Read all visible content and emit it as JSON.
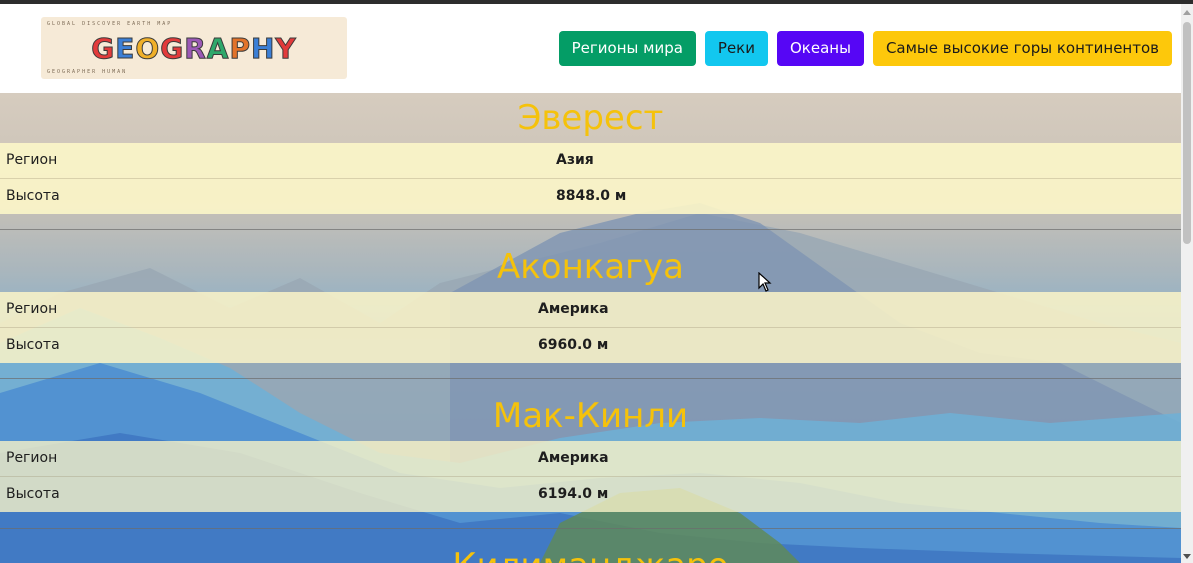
{
  "header": {
    "logo": {
      "word_letters": [
        "G",
        "E",
        "O",
        "G",
        "R",
        "A",
        "P",
        "H",
        "Y"
      ],
      "letter_colors": [
        "#e23b3b",
        "#3b7fd6",
        "#f0b02a",
        "#e23b3b",
        "#9b59b6",
        "#2ea86b",
        "#e2732a",
        "#3b7fd6",
        "#e23b3b"
      ],
      "scribble_top": "GLOBAL DISCOVER EARTH MAP",
      "scribble_bottom": "GEOGRAPHER HUMAN"
    },
    "nav": [
      {
        "label": "Регионы мира",
        "color": "#049d66"
      },
      {
        "label": "Реки",
        "color": "#12c7ef"
      },
      {
        "label": "Океаны",
        "color": "#5606f5"
      },
      {
        "label": "Самые высокие горы континентов",
        "color": "#fdc80b"
      }
    ]
  },
  "mountains": [
    {
      "name": "Эверест",
      "region_label": "Регион",
      "region": "Азия",
      "height_label": "Высота",
      "height": "8848.0 м"
    },
    {
      "name": "Аконкагуа",
      "region_label": "Регион",
      "region": "Америка",
      "height_label": "Высота",
      "height": "6960.0 м"
    },
    {
      "name": "Мак-Кинли",
      "region_label": "Регион",
      "region": "Америка",
      "height_label": "Высота",
      "height": "6194.0 м"
    },
    {
      "name": "Килиманджаро"
    }
  ],
  "colors": {
    "title": "#f5c20b",
    "row_bg": "#fbf5c8"
  }
}
